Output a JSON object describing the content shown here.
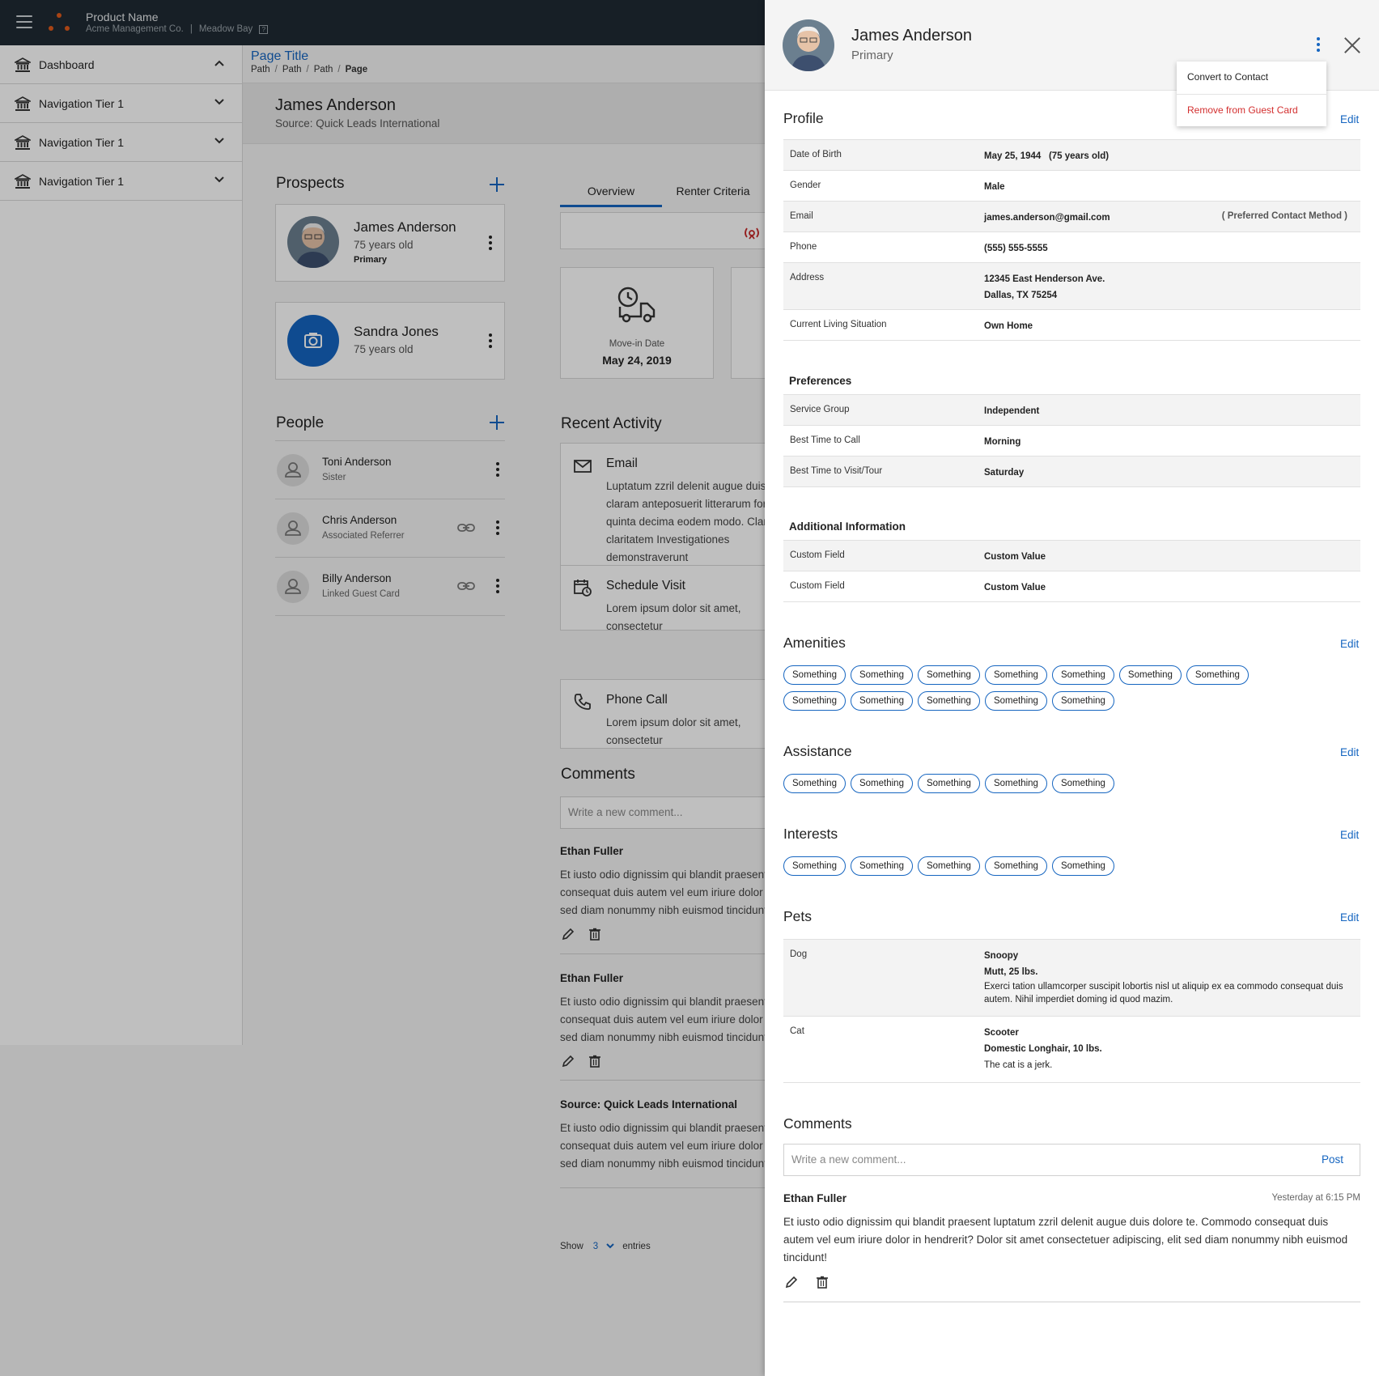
{
  "topbar": {
    "product_name": "Product Name",
    "company": "Acme Management Co.",
    "property": "Meadow Bay",
    "help_glyph": "?"
  },
  "sidebar": {
    "items": [
      {
        "label": "Dashboard",
        "icon": "bank-icon",
        "chevron": "chevron-up-icon"
      },
      {
        "label": "Navigation Tier 1",
        "icon": "bank-icon",
        "chevron": "chevron-down-icon"
      },
      {
        "label": "Navigation Tier 1",
        "icon": "bank-icon",
        "chevron": "chevron-down-icon"
      },
      {
        "label": "Navigation Tier 1",
        "icon": "bank-icon",
        "chevron": "chevron-down-icon"
      }
    ]
  },
  "header": {
    "page_title": "Page Title",
    "breadcrumb": [
      "Path",
      "Path",
      "Path",
      "Page"
    ]
  },
  "hero": {
    "name": "James Anderson",
    "source": "Source: Quick Leads International"
  },
  "prospects": {
    "title": "Prospects",
    "cards": [
      {
        "name": "James Anderson",
        "age": "75 years old",
        "tag": "Primary"
      },
      {
        "name": "Sandra Jones",
        "age": "75 years old"
      }
    ]
  },
  "people": {
    "title": "People",
    "items": [
      {
        "name": "Toni Anderson",
        "relation": "Sister"
      },
      {
        "name": "Chris Anderson",
        "relation": "Associated Referrer"
      },
      {
        "name": "Billy Anderson",
        "relation": "Linked Guest Card"
      }
    ]
  },
  "tabs": [
    "Overview",
    "Renter Criteria"
  ],
  "tile": {
    "label": "Move-in Date",
    "value": "May 24, 2019"
  },
  "recent_activity": {
    "title": "Recent Activity",
    "items": [
      {
        "title": "Email",
        "body": "Luptatum zzril delenit augue duis claram anteposuerit litterarum formas quinta decima eodem modo. Claritas claritatem Investigationes demonstraverunt"
      },
      {
        "title": "Schedule Visit",
        "body": "Lorem ipsum dolor sit amet, consectetur"
      },
      {
        "title": "Phone Call",
        "body": "Lorem ipsum dolor sit amet, consectetur"
      }
    ]
  },
  "comments": {
    "title": "Comments",
    "placeholder": "Write a new comment...",
    "items": [
      {
        "author": "Ethan Fuller",
        "body": "Et iusto odio dignissim qui blandit praesent consequat duis autem vel eum iriure dolor sed diam nonummy nibh euismod tincidunt"
      },
      {
        "author": "Ethan Fuller",
        "body": "Et iusto odio dignissim qui blandit praesent consequat duis autem vel eum iriure dolor sed diam nonummy nibh euismod tincidunt"
      },
      {
        "author": "Source: Quick Leads International",
        "body": "Et iusto odio dignissim qui blandit praesent consequat duis autem vel eum iriure dolor sed diam nonummy nibh euismod tincidunt"
      }
    ],
    "pager": {
      "show": "Show",
      "count": "3",
      "entries": "entries"
    }
  },
  "panel": {
    "name": "James Anderson",
    "role": "Primary",
    "menu": [
      "Convert to Contact",
      "Remove from Guest Card"
    ],
    "edit_label": "Edit",
    "profile": {
      "title": "Profile",
      "rows": [
        {
          "key": "Date of Birth",
          "value": "May 25, 1944",
          "extra": "(75 years old)"
        },
        {
          "key": "Gender",
          "value": "Male"
        },
        {
          "key": "Email",
          "value": "james.anderson@gmail.com",
          "note": "( Preferred Contact Method )"
        },
        {
          "key": "Phone",
          "value": "(555) 555-5555"
        },
        {
          "key": "Address",
          "value": "12345 East Henderson Ave.",
          "value2": "Dallas, TX 75254"
        },
        {
          "key": "Current Living Situation",
          "value": "Own Home"
        }
      ]
    },
    "preferences": {
      "title": "Preferences",
      "rows": [
        {
          "key": "Service Group",
          "value": "Independent"
        },
        {
          "key": "Best Time to Call",
          "value": "Morning"
        },
        {
          "key": "Best Time to Visit/Tour",
          "value": "Saturday"
        }
      ]
    },
    "additional": {
      "title": "Additional Information",
      "rows": [
        {
          "key": "Custom Field",
          "value": "Custom Value"
        },
        {
          "key": "Custom Field",
          "value": "Custom Value"
        }
      ]
    },
    "amenities": {
      "title": "Amenities",
      "chips": [
        "Something",
        "Something",
        "Something",
        "Something",
        "Something",
        "Something",
        "Something",
        "Something",
        "Something",
        "Something",
        "Something",
        "Something"
      ]
    },
    "assistance": {
      "title": "Assistance",
      "chips": [
        "Something",
        "Something",
        "Something",
        "Something",
        "Something"
      ]
    },
    "interests": {
      "title": "Interests",
      "chips": [
        "Something",
        "Something",
        "Something",
        "Something",
        "Something"
      ]
    },
    "pets": {
      "title": "Pets",
      "rows": [
        {
          "key": "Dog",
          "name": "Snoopy",
          "detail": "Mutt, 25 lbs.",
          "note": "Exerci tation ullamcorper suscipit lobortis nisl ut aliquip ex ea commodo consequat duis autem. Nihil imperdiet doming id quod mazim."
        },
        {
          "key": "Cat",
          "name": "Scooter",
          "detail": "Domestic Longhair, 10 lbs.",
          "note": "The cat is a jerk."
        }
      ]
    },
    "comments": {
      "title": "Comments",
      "placeholder": "Write a new comment...",
      "post_label": "Post",
      "author": "Ethan Fuller",
      "time": "Yesterday at 6:15 PM",
      "body": "Et iusto odio dignissim qui blandit praesent luptatum zzril delenit augue duis dolore te. Commodo consequat duis autem vel eum iriure dolor in hendrerit? Dolor sit amet consectetuer adipiscing, elit sed diam nonummy nibh euismod tincidunt!"
    }
  },
  "colors": {
    "accent": "#1565c0",
    "danger": "#d32f2f",
    "topbar": "#1f2a33",
    "logo": "#e05a1b"
  }
}
